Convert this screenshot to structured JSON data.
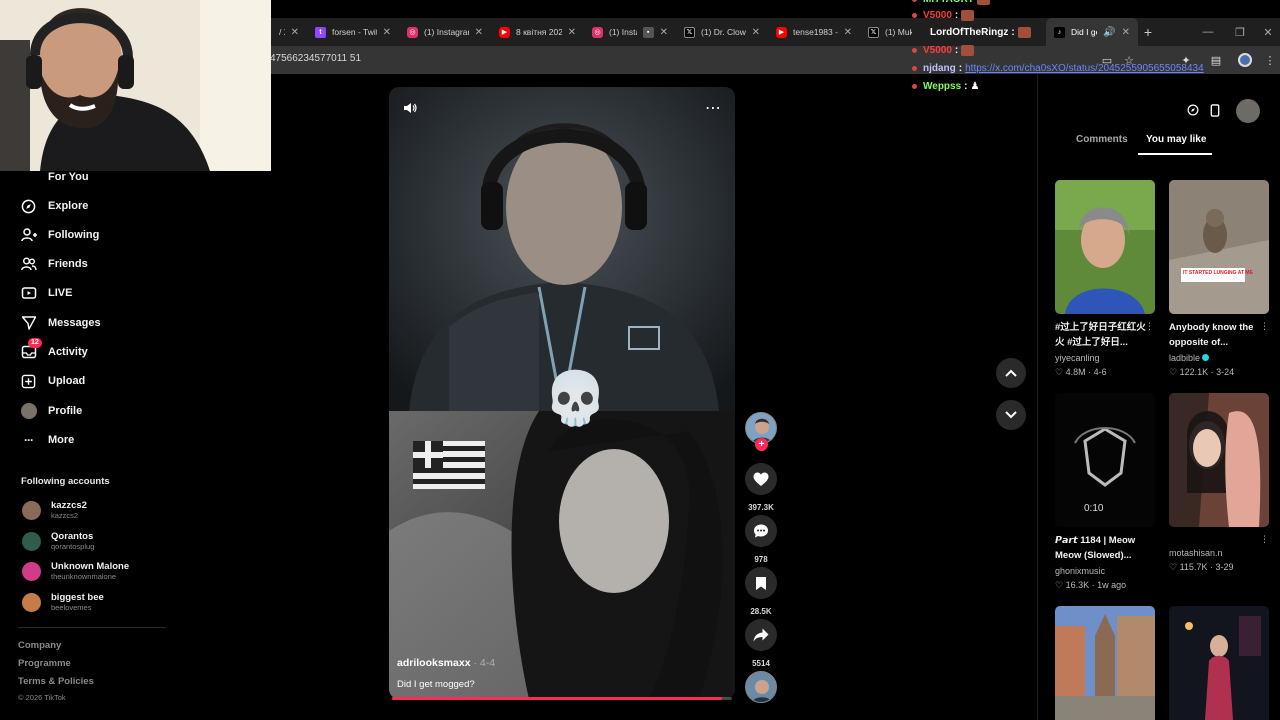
{
  "browser": {
    "tabs": [
      {
        "title": "/ X",
        "icon": "x-icon"
      },
      {
        "title": "forsen - Twit",
        "icon": "twitch-icon"
      },
      {
        "title": "(1) Instagran",
        "icon": "instagram-icon"
      },
      {
        "title": "8 квітня 202",
        "icon": "youtube-icon"
      },
      {
        "title": "(1) Insta",
        "icon": "instagram-icon"
      },
      {
        "title": "(1) Dr. Clow",
        "icon": "x-icon"
      },
      {
        "title": "tense1983 -",
        "icon": "youtube-icon"
      },
      {
        "title": "(1) Mukh",
        "icon": "x-icon"
      },
      {
        "title": "Did I get",
        "icon": "tiktok-icon"
      }
    ],
    "active_tab_index": 8,
    "url_fragment": "47566234577011 51",
    "new_tab": "+",
    "colors": {
      "twitch": "#9146ff",
      "instagram": "#e1306c",
      "youtube": "#ff0000",
      "x": "#000000"
    }
  },
  "chat": {
    "lines": [
      {
        "user": "V5000",
        "color": "#ff3b3b",
        "text": ":"
      },
      {
        "user": "LordOfTheRingz",
        "color": "#ffffff",
        "text": ":"
      },
      {
        "user": "V5000",
        "color": "#ff3b3b",
        "text": ":"
      },
      {
        "user": "njdang",
        "color": "#c0c0ff",
        "text": ":",
        "link": "https://x.com/cha0sXO/status/2045255905655058434"
      },
      {
        "user": "Weppss",
        "color": "#7fff5a",
        "text": ":"
      }
    ]
  },
  "nav": {
    "items": [
      {
        "label": "For You",
        "icon": "home-icon"
      },
      {
        "label": "Explore",
        "icon": "compass-icon"
      },
      {
        "label": "Following",
        "icon": "user-follow-icon"
      },
      {
        "label": "Friends",
        "icon": "friends-icon"
      },
      {
        "label": "LIVE",
        "icon": "live-icon"
      },
      {
        "label": "Messages",
        "icon": "send-icon"
      },
      {
        "label": "Activity",
        "icon": "inbox-icon",
        "badge": "12"
      },
      {
        "label": "Upload",
        "icon": "upload-icon"
      },
      {
        "label": "Profile",
        "icon": "avatar"
      },
      {
        "label": "More",
        "icon": "more-icon"
      }
    ]
  },
  "following": {
    "heading": "Following accounts",
    "accounts": [
      {
        "name": "kazzcs2",
        "handle": "kazzcs2",
        "color": "#8a6a5a"
      },
      {
        "name": "Qorantos",
        "handle": "qorantosplug",
        "color": "#2f5d4a"
      },
      {
        "name": "Unknown Malone",
        "handle": "theunknownmalone",
        "color": "#d23a8a"
      },
      {
        "name": "biggest bee",
        "handle": "beelovemes",
        "color": "#c77a4a"
      }
    ]
  },
  "footer": {
    "company": "Company",
    "programme": "Programme",
    "terms": "Terms & Policies",
    "copyright": "© 2026 TikTok"
  },
  "video": {
    "author": "adrilooksmaxx",
    "date": " · 4-4",
    "caption": "Did I get mogged?",
    "skull_emoji": "💀",
    "progress": 0.97
  },
  "actions": {
    "likes": "397.3K",
    "comments": "978",
    "saves": "28.5K",
    "shares": "5514"
  },
  "panel": {
    "tabs": [
      "Comments",
      "You may like"
    ],
    "active_tab": 1,
    "cards": [
      {
        "title": "#过上了好日子红红火火 #过上了好日...",
        "user": "yiyecanling",
        "likes": "4.8M",
        "date": "4-6",
        "verified": false
      },
      {
        "title": "Anybody know the opposite of...",
        "user": "ladbible",
        "likes": "122.1K",
        "date": "3-24",
        "verified": true,
        "thumb_text": "IT STARTED LUNGING AT ME"
      },
      {
        "title": "𝙋𝙖𝙧𝙩 1184 | Meow Meow (Slowed)...",
        "user": "ghonixmusic",
        "likes": "16.3K",
        "date": "1w ago",
        "verified": false,
        "thumb_text": "0:10"
      },
      {
        "title": "",
        "user": "motashisan.n",
        "likes": "115.7K",
        "date": "3-29",
        "verified": false
      },
      {
        "title": "",
        "user": "",
        "likes": "",
        "date": "",
        "verified": false
      },
      {
        "title": "",
        "user": "",
        "likes": "",
        "date": "",
        "verified": false
      }
    ]
  },
  "colors": {
    "accent": "#fe2c55",
    "bg": "#000000",
    "verified": "#20d5ec"
  }
}
